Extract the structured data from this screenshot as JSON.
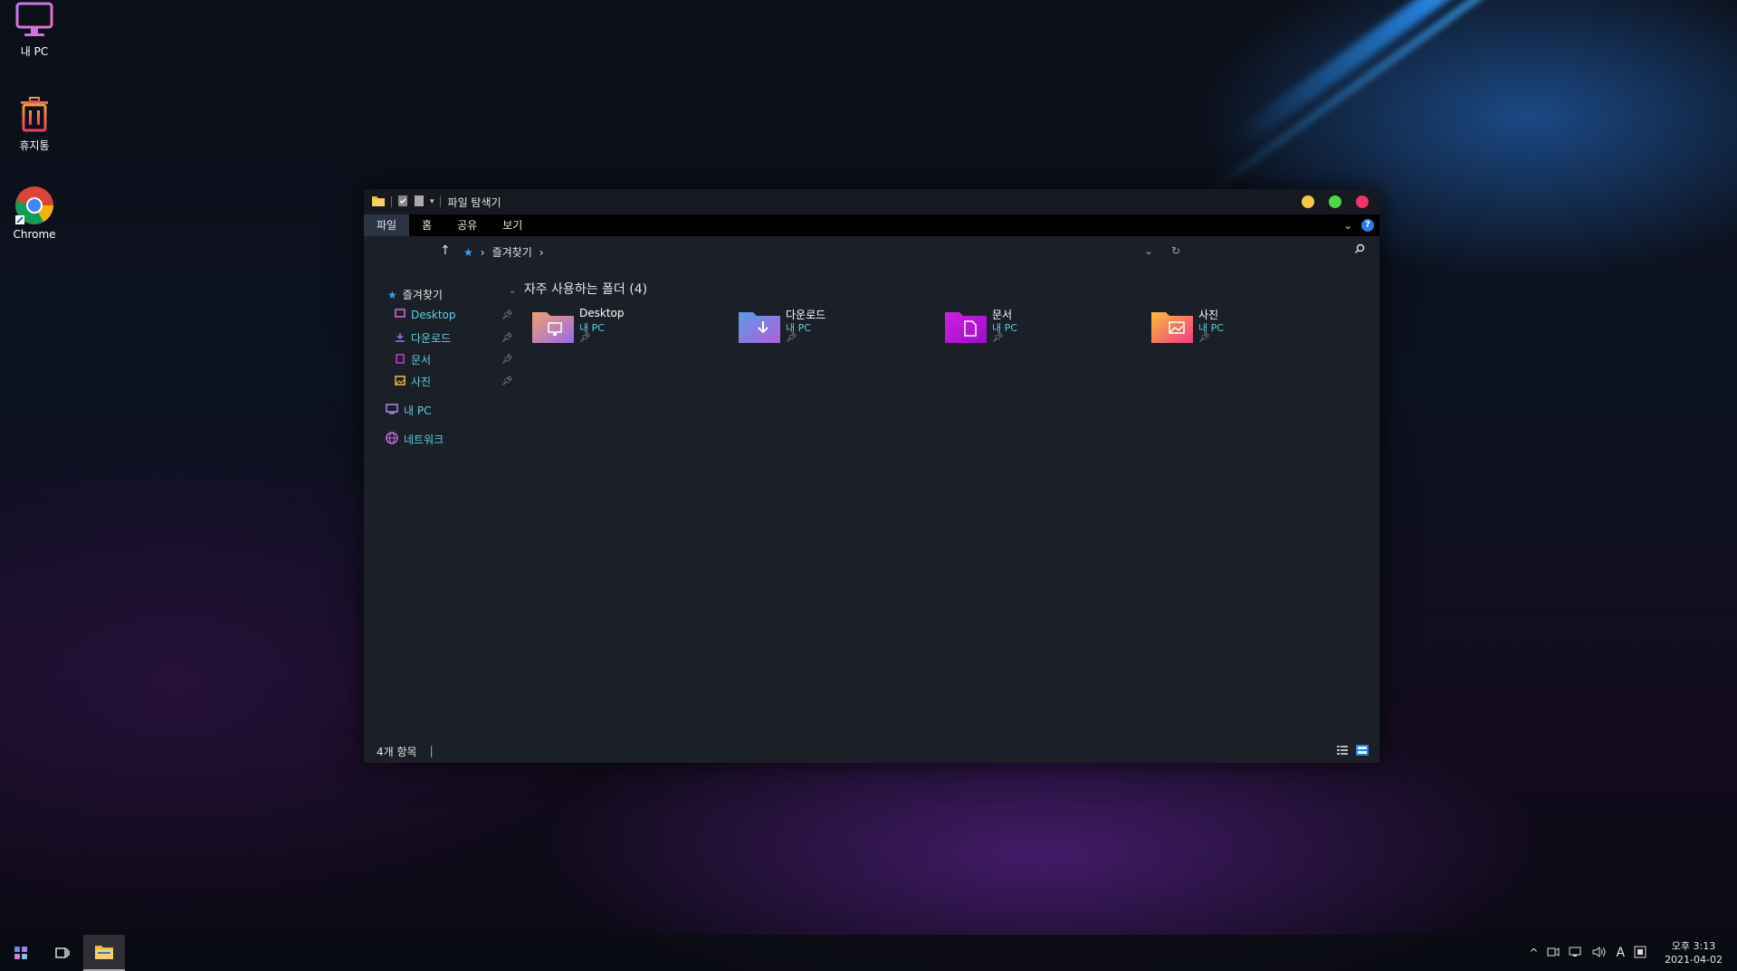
{
  "desktop": {
    "icons": [
      {
        "label": "내 PC",
        "icon": "monitor-icon"
      },
      {
        "label": "휴지통",
        "icon": "trash-icon"
      },
      {
        "label": "Chrome",
        "icon": "chrome-icon"
      }
    ]
  },
  "window": {
    "title": "파일 탐색기",
    "ribbon_tabs": [
      "파일",
      "홈",
      "공유",
      "보기"
    ],
    "active_tab": "파일",
    "help_label": "?",
    "address": {
      "segment": "즐겨찾기"
    },
    "nav": {
      "quick_access": "즐겨찾기",
      "items": [
        {
          "label": "Desktop",
          "color": "#e06ad8"
        },
        {
          "label": "다운로드",
          "color": "#8a7ae0"
        },
        {
          "label": "문서",
          "color": "#c040d8"
        },
        {
          "label": "사진",
          "color": "#f0c040"
        }
      ],
      "this_pc": "내 PC",
      "network": "네트워크"
    },
    "section_title": "자주 사용하는 폴더 (4)",
    "folders": [
      {
        "name": "Desktop",
        "location": "내 PC",
        "icon": "desktop-folder-icon"
      },
      {
        "name": "다운로드",
        "location": "내 PC",
        "icon": "downloads-folder-icon"
      },
      {
        "name": "문서",
        "location": "내 PC",
        "icon": "documents-folder-icon"
      },
      {
        "name": "사진",
        "location": "내 PC",
        "icon": "pictures-folder-icon"
      }
    ],
    "status": "4개 항목",
    "traffic_colors": [
      "#f5c84a",
      "#4fd84a",
      "#f0346a"
    ]
  },
  "taskbar": {
    "clock_time": "오후 3:13",
    "clock_date": "2021-04-02",
    "ime": "A"
  }
}
